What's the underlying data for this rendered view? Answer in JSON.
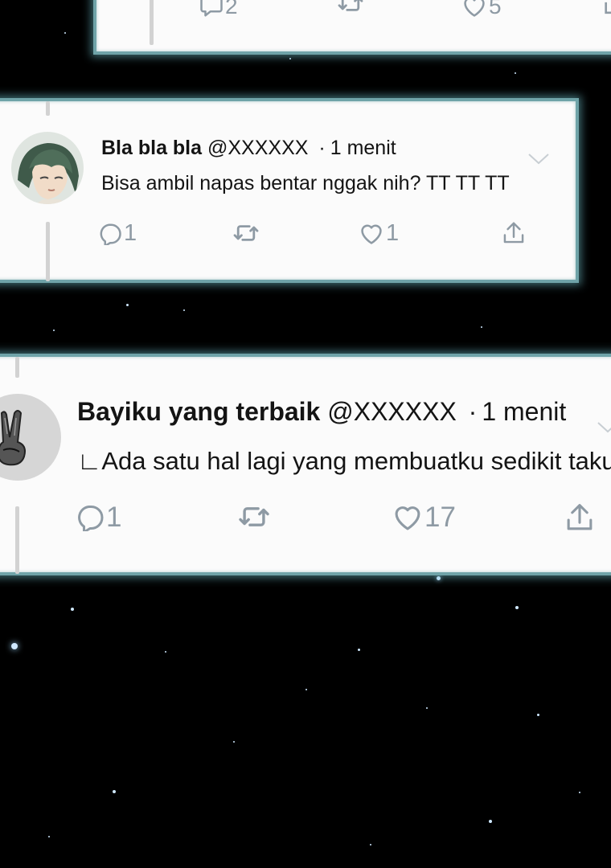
{
  "tweets": [
    {
      "id": "top-partial",
      "actions": {
        "reply_count": "2",
        "like_count": "5"
      }
    },
    {
      "id": "tweet-1",
      "display_name": "Bla bla bla",
      "handle": "@XXXXXX",
      "separator": "·",
      "time": "1 menit",
      "text": "Bisa ambil napas bentar nggak nih? TT TT TT",
      "avatar_icon": "anime-character-avatar",
      "actions": {
        "reply_count": "1",
        "like_count": "1"
      }
    },
    {
      "id": "tweet-2",
      "display_name": "Bayiku yang terbaik",
      "handle": "@XXXXXX",
      "separator": "·",
      "time": "1 menit",
      "text": "∟Ada satu hal lagi yang membuatku sedikit takut.",
      "avatar_icon": "peace-sign-avatar",
      "actions": {
        "reply_count": "1",
        "like_count": "17"
      }
    }
  ],
  "icons": [
    "reply-icon",
    "retweet-icon",
    "like-icon",
    "share-icon",
    "chevron-down-icon"
  ],
  "colors": {
    "background": "#000000",
    "card_background": "#fbfbfb",
    "card_border_glow": "#6fa3a8",
    "text": "#141414",
    "icon_gray": "#8e9aa4",
    "thread_line": "#d2d2d2"
  }
}
